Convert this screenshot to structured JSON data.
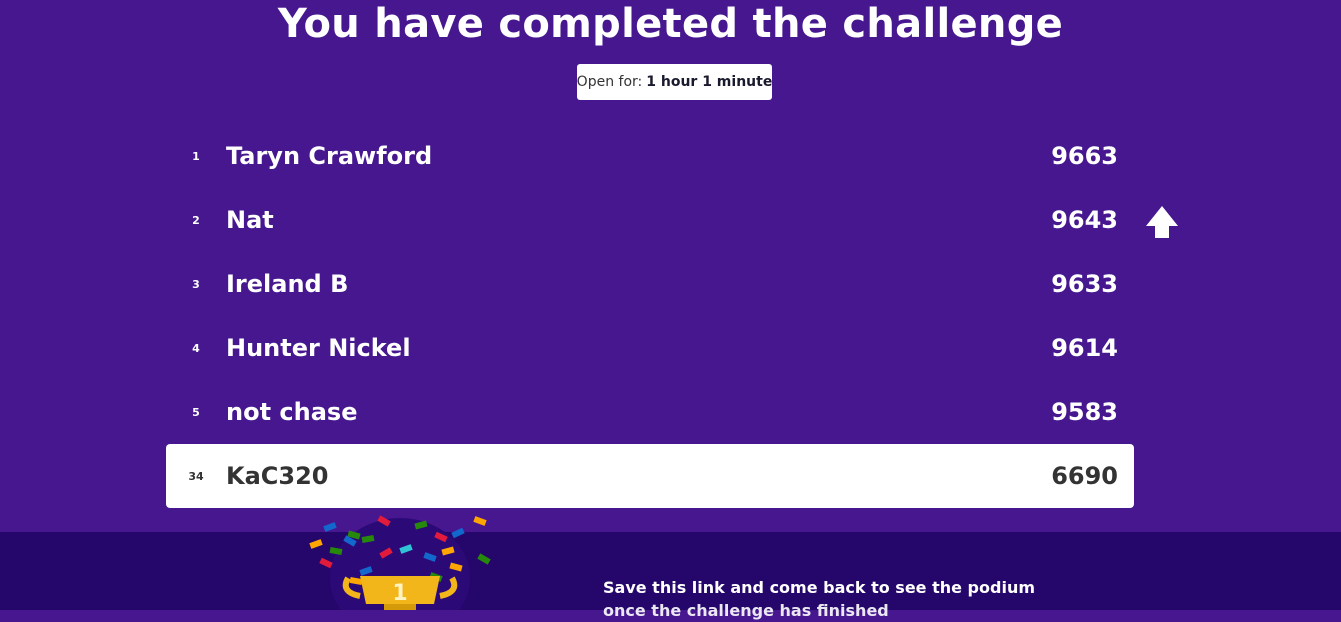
{
  "header": {
    "title": "You have completed the challenge"
  },
  "timer": {
    "label": "Open for:",
    "value": "1 hour 1 minute"
  },
  "leaderboard": [
    {
      "rank": "1",
      "name": "Taryn Crawford",
      "score": "9663"
    },
    {
      "rank": "2",
      "name": "Nat",
      "score": "9643"
    },
    {
      "rank": "3",
      "name": "Ireland B",
      "score": "9633"
    },
    {
      "rank": "4",
      "name": "Hunter Nickel",
      "score": "9614"
    },
    {
      "rank": "5",
      "name": "not chase",
      "score": "9583"
    }
  ],
  "current_player": {
    "rank": "34",
    "name": "KaC320",
    "score": "6690"
  },
  "footer": {
    "message": "Save this link and come back to see the podium",
    "message_line2": "once the challenge has finished",
    "trophy_badge": "1"
  },
  "colors": {
    "background": "#46178f",
    "footer": "#25076b"
  },
  "icons": {
    "scroll_up": "arrow-up-icon",
    "trophy": "trophy-icon"
  }
}
